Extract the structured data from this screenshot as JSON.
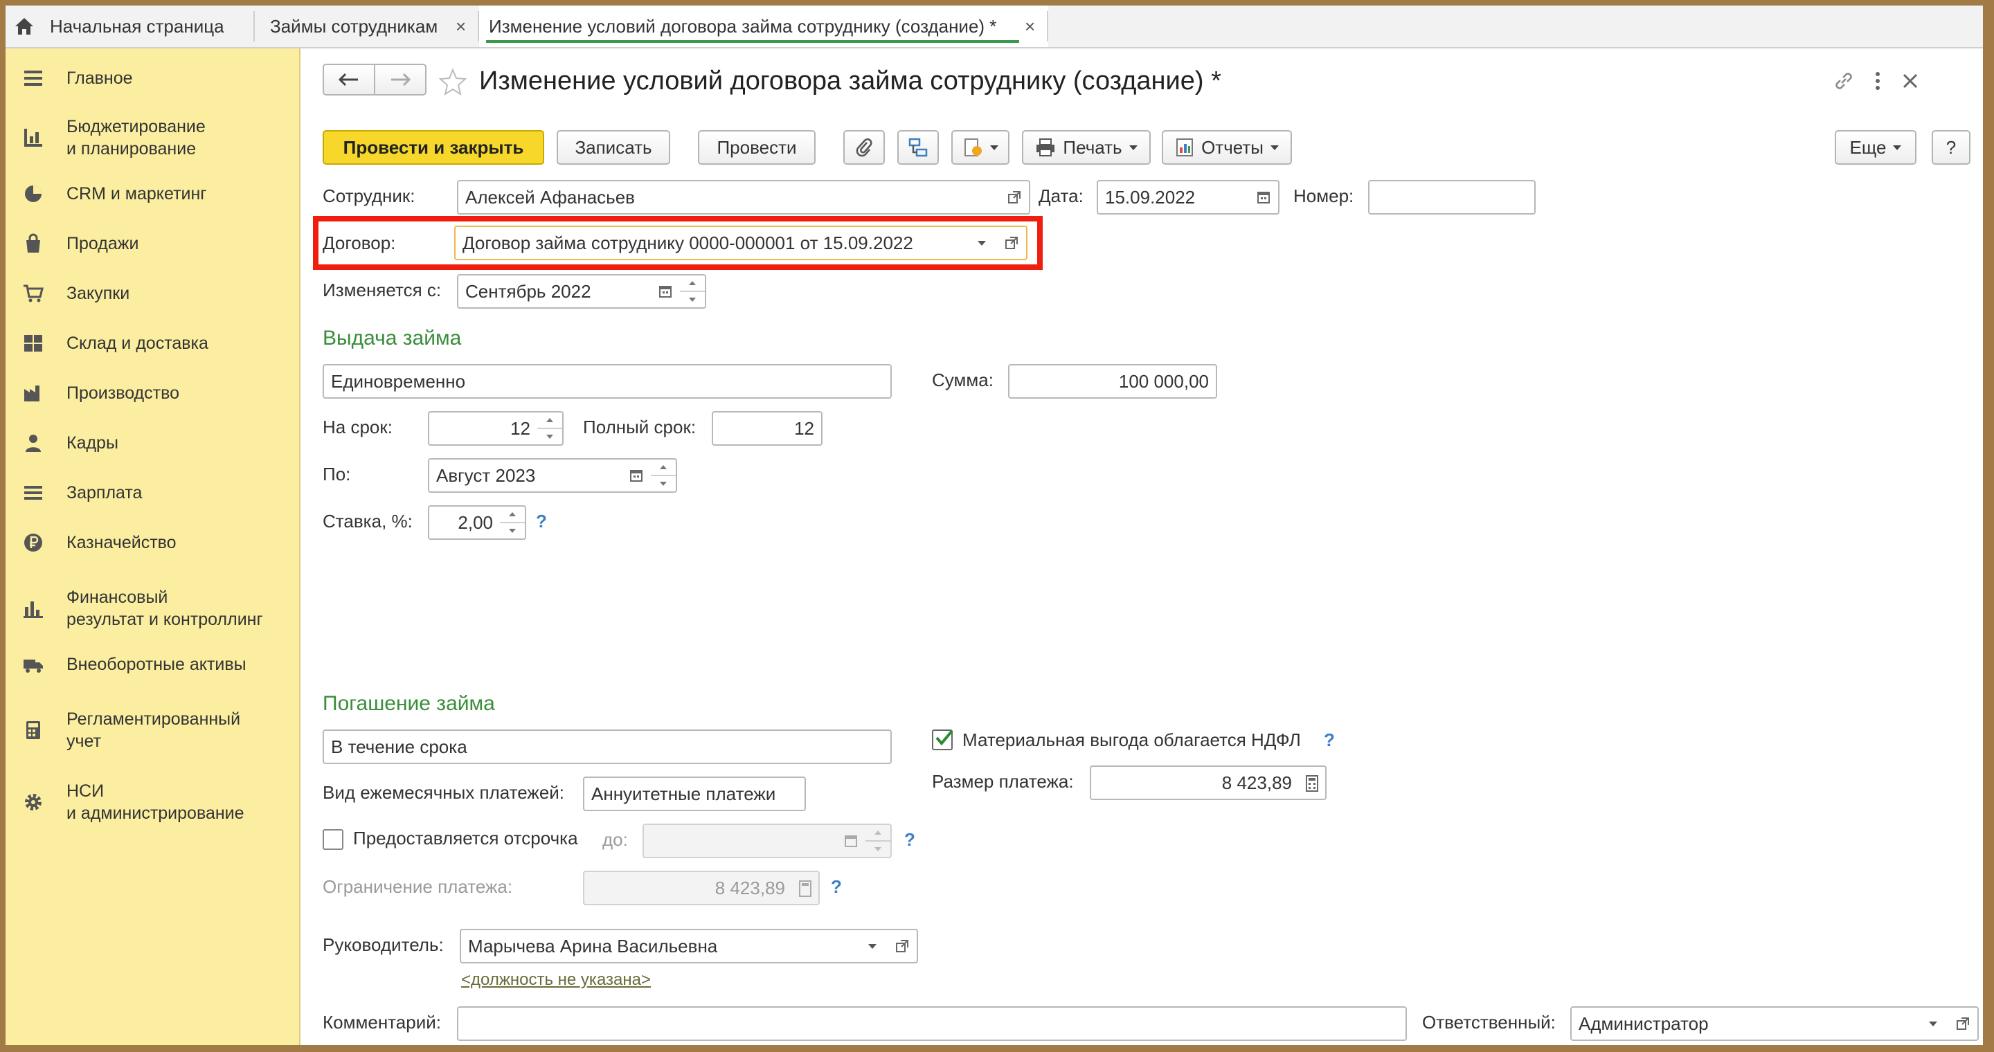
{
  "tabs": {
    "home": "Начальная страница",
    "loans": "Займы сотрудникам",
    "active": "Изменение условий договора займа сотруднику (создание) *",
    "close": "×"
  },
  "sidebar": {
    "items": [
      {
        "label": "Главное",
        "icon": "menu-icon"
      },
      {
        "label": "Бюджетирование\nи планирование",
        "icon": "budget-icon"
      },
      {
        "label": "CRM и маркетинг",
        "icon": "crm-pie-icon"
      },
      {
        "label": "Продажи",
        "icon": "shopping-bag-icon"
      },
      {
        "label": "Закупки",
        "icon": "cart-icon"
      },
      {
        "label": "Склад и доставка",
        "icon": "warehouse-icon"
      },
      {
        "label": "Производство",
        "icon": "factory-icon"
      },
      {
        "label": "Кадры",
        "icon": "person-icon"
      },
      {
        "label": "Зарплата",
        "icon": "salary-icon"
      },
      {
        "label": "Казначейство",
        "icon": "ruble-coin-icon"
      },
      {
        "label": "Финансовый\nрезультат и контроллинг",
        "icon": "bar-chart-icon"
      },
      {
        "label": "Внеоборотные активы",
        "icon": "truck-icon"
      },
      {
        "label": "Регламентированный\nучет",
        "icon": "calculator-icon"
      },
      {
        "label": "НСИ\nи администрирование",
        "icon": "gear-icon"
      }
    ]
  },
  "form": {
    "title": "Изменение условий договора займа сотруднику (создание) *",
    "toolbar": {
      "post_close": "Провести и закрыть",
      "save": "Записать",
      "post": "Провести",
      "print": "Печать",
      "reports": "Отчеты",
      "more": "Еще",
      "help": "?"
    },
    "employee_label": "Сотрудник:",
    "employee_value": "Алексей Афанасьев",
    "date_label": "Дата:",
    "date_value": "15.09.2022",
    "number_label": "Номер:",
    "number_value": "",
    "contract_label": "Договор:",
    "contract_value": "Договор займа сотруднику 0000-000001 от 15.09.2022",
    "changes_from_label": "Изменяется с:",
    "changes_from_value": "Сентябрь 2022",
    "issue_section": "Выдача займа",
    "issue_method": "Единовременно",
    "amount_label": "Сумма:",
    "amount_value": "100 000,00",
    "term_label": "На срок:",
    "term_value": "12",
    "full_term_label": "Полный срок:",
    "full_term_value": "12",
    "until_label": "По:",
    "until_value": "Август 2023",
    "rate_label": "Ставка, %:",
    "rate_value": "2,00",
    "repay_section": "Погашение займа",
    "repay_method": "В течение срока",
    "ndfl_label": "Материальная выгода облагается НДФЛ",
    "ndfl_checked": true,
    "monthly_type_label": "Вид ежемесячных платежей:",
    "monthly_type_value": "Аннуитетные платежи",
    "payment_size_label": "Размер платежа:",
    "payment_size_value": "8 423,89",
    "deferral_label": "Предоставляется отсрочка",
    "deferral_checked": false,
    "deferral_until_label": "до:",
    "deferral_until_value": "",
    "payment_limit_label": "Ограничение платежа:",
    "payment_limit_value": "8 423,89",
    "head_label": "Руководитель:",
    "head_value": "Марычева Арина Васильевна",
    "position_link": "<должность не указана>",
    "comment_label": "Комментарий:",
    "comment_value": "",
    "responsible_label": "Ответственный:",
    "responsible_value": "Администратор"
  },
  "colors": {
    "sidebar_bg": "#fbeea0",
    "primary_button": "#f7d72a",
    "section_title": "#3a8d3a",
    "highlight_box": "#f01e0f",
    "outer_frame": "#a27a46"
  }
}
